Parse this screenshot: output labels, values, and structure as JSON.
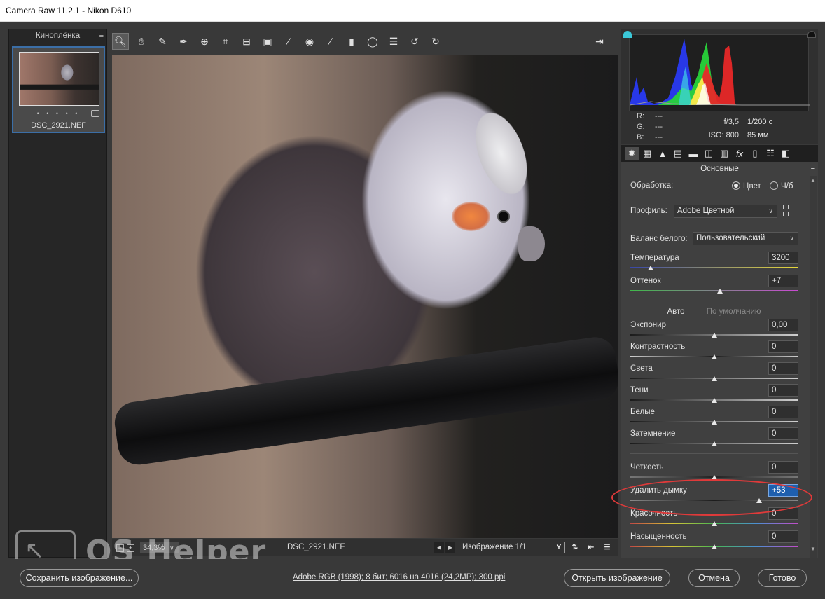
{
  "window": {
    "title": "Camera Raw 11.2.1  -  Nikon D610"
  },
  "filmstrip": {
    "title": "Киноплёнка",
    "thumbnail": {
      "rating_dots": "• • • • •",
      "filename": "DSC_2921.NEF"
    }
  },
  "toolbar": {
    "tools": [
      "zoom-tool",
      "hand-tool",
      "white-balance-tool",
      "color-sampler-tool",
      "targeted-adjustment-tool",
      "crop-tool",
      "straighten-tool",
      "transform-tool",
      "spot-removal-tool",
      "red-eye-tool",
      "adjustment-brush-tool",
      "graduated-filter-tool",
      "radial-filter-tool",
      "preferences-tool",
      "rotate-left-tool",
      "rotate-right-tool"
    ]
  },
  "image_status": {
    "zoom": "34,3%",
    "filename": "DSC_2921.NEF",
    "image_count": "Изображение 1/1"
  },
  "histogram": {
    "r_label": "R:",
    "g_label": "G:",
    "b_label": "B:",
    "r_value": "---",
    "g_value": "---",
    "b_value": "---",
    "aperture": "f/3,5",
    "shutter": "1/200 с",
    "iso": "ISO: 800",
    "focal": "85 мм"
  },
  "panel": {
    "title": "Основные",
    "processing_label": "Обработка:",
    "color_option": "Цвет",
    "bw_option": "Ч/б",
    "profile_label": "Профиль:",
    "profile_value": "Adobe Цветной",
    "wb_label": "Баланс белого:",
    "wb_value": "Пользовательский",
    "auto_link": "Авто",
    "default_link": "По умолчанию",
    "sliders": [
      {
        "label": "Температура",
        "value": "3200",
        "position": 0.12
      },
      {
        "label": "Оттенок",
        "value": "+7",
        "position": 0.535
      },
      {
        "label": "Экспонир",
        "value": "0,00",
        "position": 0.5
      },
      {
        "label": "Контрастность",
        "value": "0",
        "position": 0.5
      },
      {
        "label": "Света",
        "value": "0",
        "position": 0.5
      },
      {
        "label": "Тени",
        "value": "0",
        "position": 0.5
      },
      {
        "label": "Белые",
        "value": "0",
        "position": 0.5
      },
      {
        "label": "Затемнение",
        "value": "0",
        "position": 0.5
      },
      {
        "label": "Четкость",
        "value": "0",
        "position": 0.5
      },
      {
        "label": "Удалить дымку",
        "value": "+53",
        "position": 0.765
      },
      {
        "label": "Красочность",
        "value": "0",
        "position": 0.5
      },
      {
        "label": "Насыщенность",
        "value": "0",
        "position": 0.5
      }
    ]
  },
  "bottom": {
    "save_button": "Сохранить изображение...",
    "file_info": "Adobe RGB (1998); 8 бит; 6016 на 4016 (24,2MP); 300 ppi",
    "open_button": "Открыть изображение",
    "cancel_button": "Отмена",
    "done_button": "Готово"
  },
  "watermark": {
    "text": "OS Helper"
  },
  "colors": {
    "accent": "#1e5fae",
    "highlight_ring": "#e03a3a",
    "selection_border": "#3b6ea6"
  }
}
